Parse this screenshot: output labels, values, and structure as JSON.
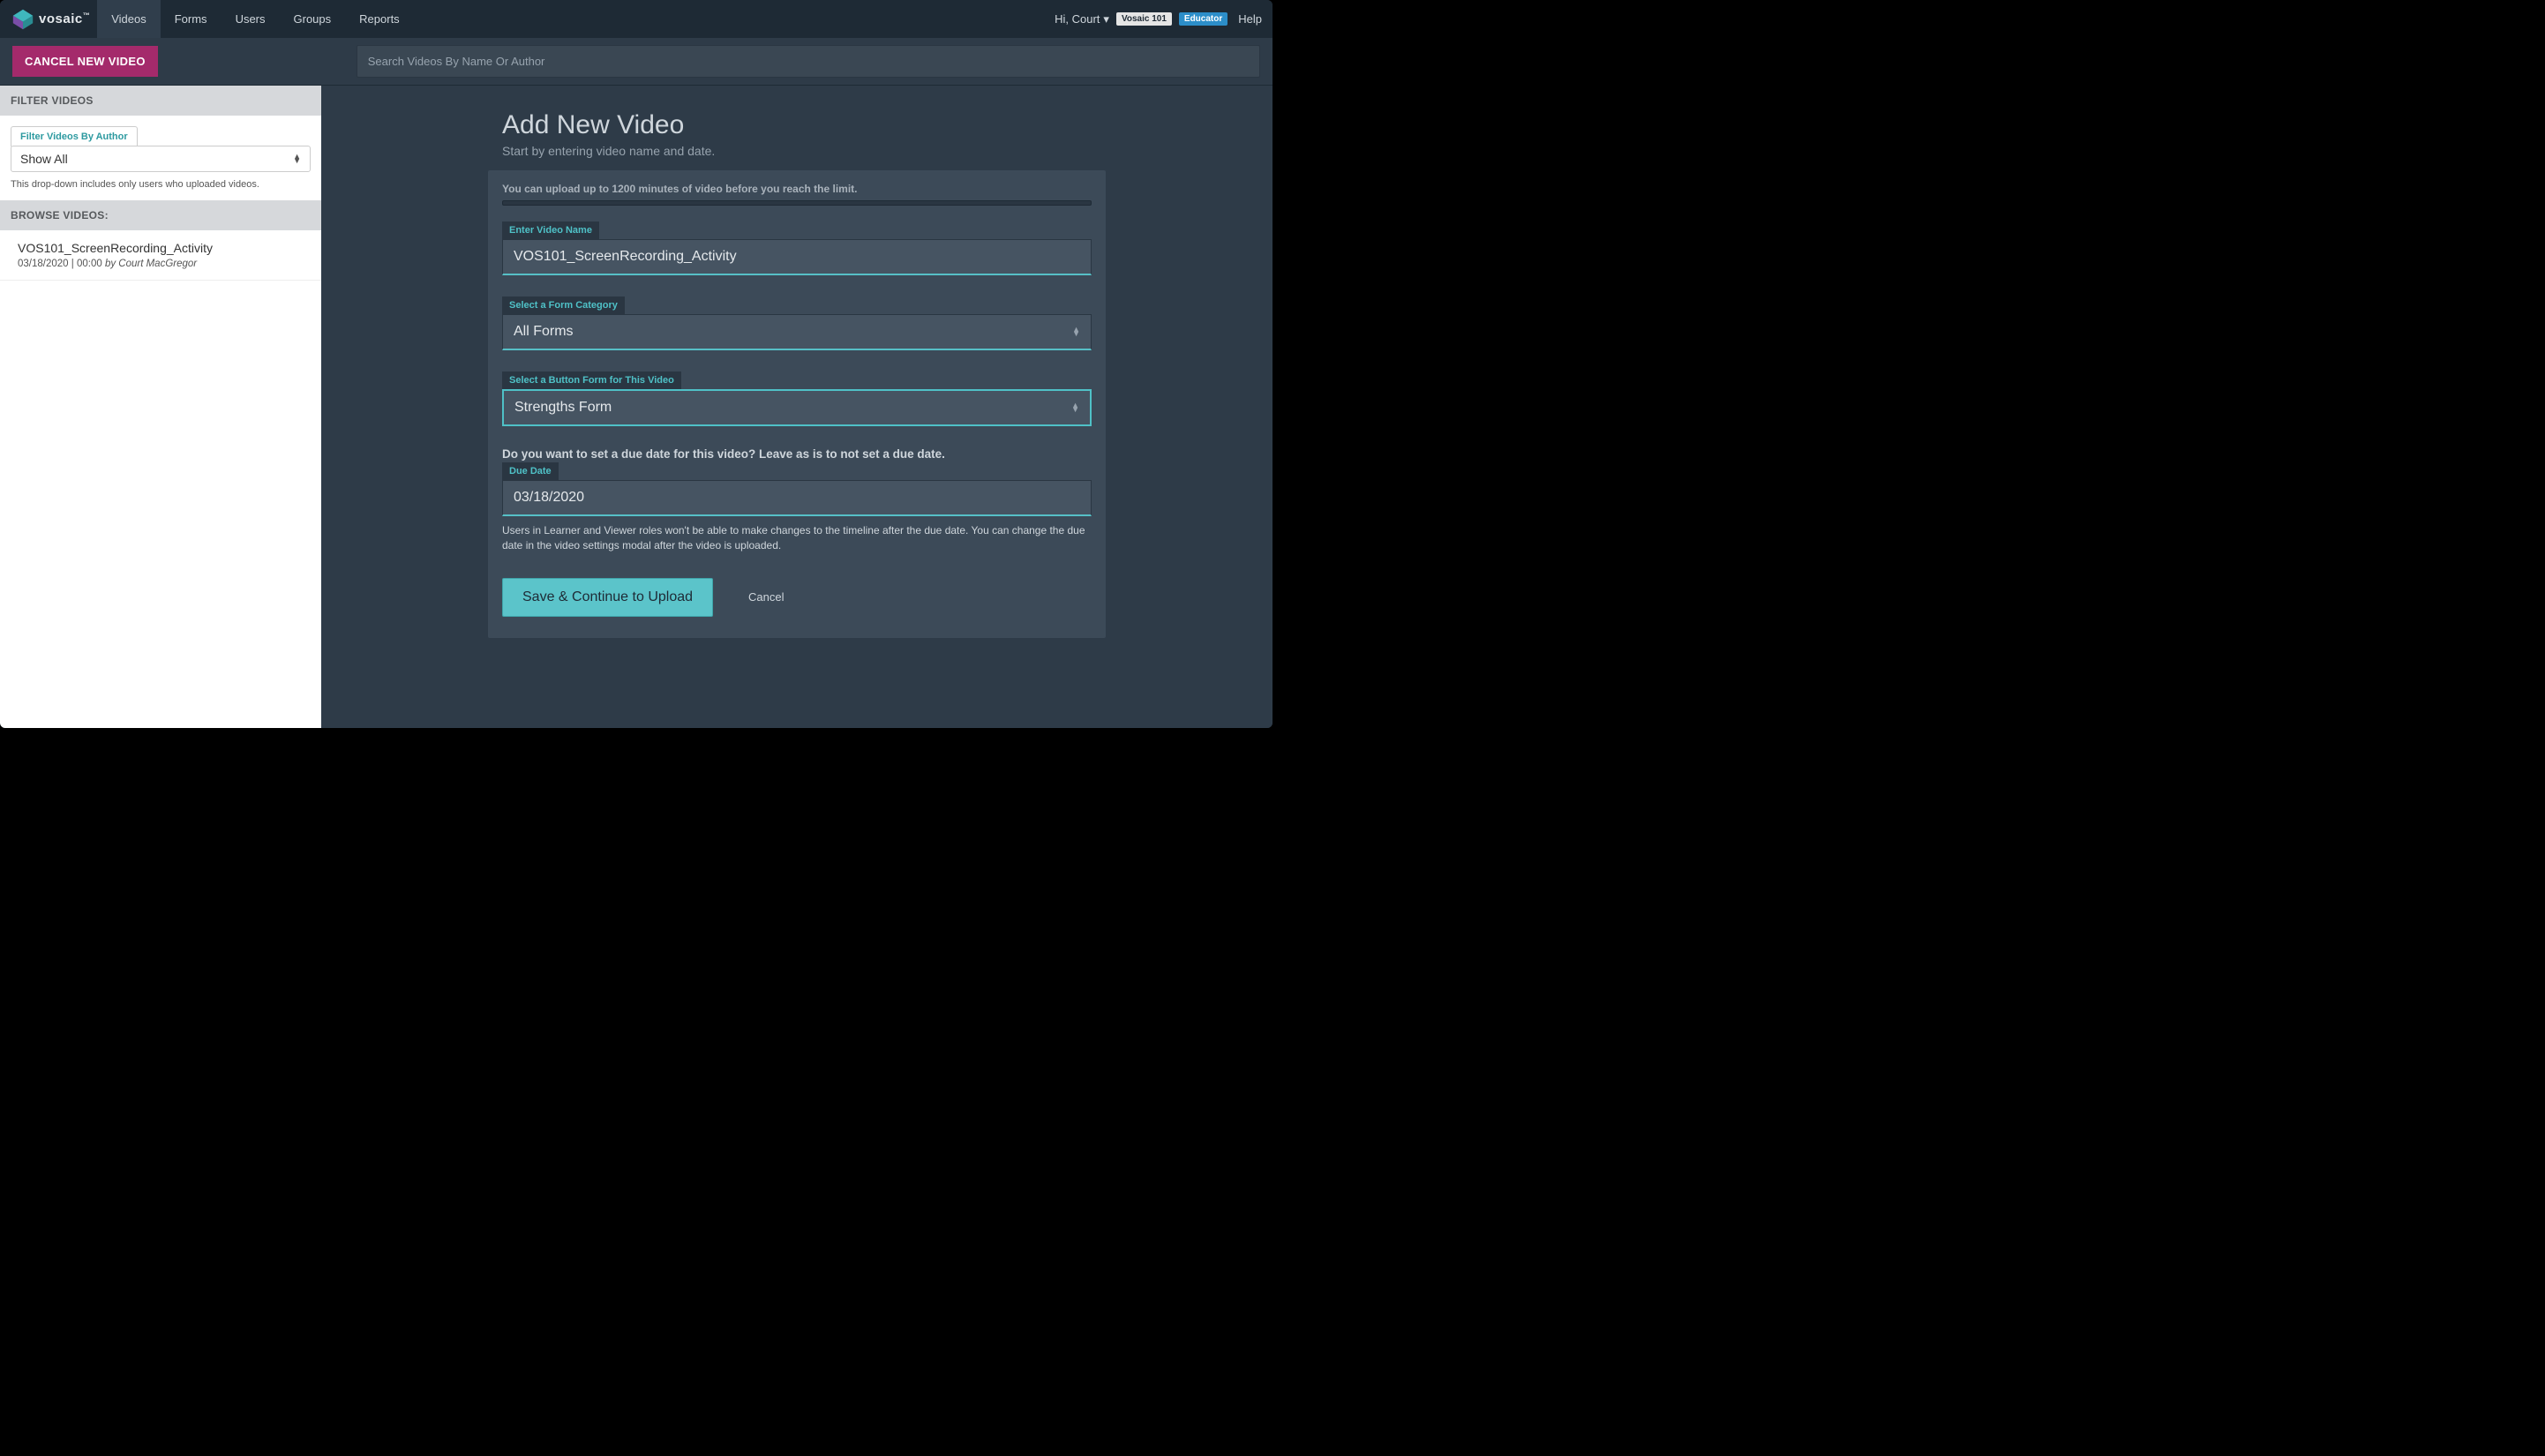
{
  "brand": {
    "name": "vosaic"
  },
  "nav": {
    "items": [
      "Videos",
      "Forms",
      "Users",
      "Groups",
      "Reports"
    ],
    "active_index": 0,
    "greeting": "Hi, Court",
    "badge1": "Vosaic 101",
    "badge2": "Educator",
    "help": "Help"
  },
  "subbar": {
    "cancel_label": "CANCEL NEW VIDEO",
    "search_placeholder": "Search Videos By Name Or Author"
  },
  "sidebar": {
    "filter_header": "FILTER VIDEOS",
    "filter_tab": "Filter Videos By Author",
    "filter_selected": "Show All",
    "filter_hint": "This drop-down includes only users who uploaded videos.",
    "browse_header": "BROWSE VIDEOS:",
    "videos": [
      {
        "title": "VOS101_ScreenRecording_Activity",
        "date": "03/18/2020",
        "duration": "00:00",
        "author": "by Court MacGregor"
      }
    ]
  },
  "main": {
    "title": "Add New Video",
    "sub": "Start by entering video name and date.",
    "limit_text": "You can upload up to 1200 minutes of video before you reach the limit.",
    "fields": {
      "name_label": "Enter Video Name",
      "name_value": "VOS101_ScreenRecording_Activity",
      "category_label": "Select a Form Category",
      "category_value": "All Forms",
      "form_label": "Select a Button Form for This Video",
      "form_value": "Strengths Form",
      "due_question": "Do you want to set a due date for this video? Leave as is to not set a due date.",
      "due_label": "Due Date",
      "due_value": "03/18/2020"
    },
    "due_note": "Users in Learner and Viewer roles won't be able to make changes to the timeline after the due date. You can change the due date in the video settings modal after the video is uploaded.",
    "save_label": "Save & Continue to Upload",
    "cancel_label": "Cancel"
  }
}
